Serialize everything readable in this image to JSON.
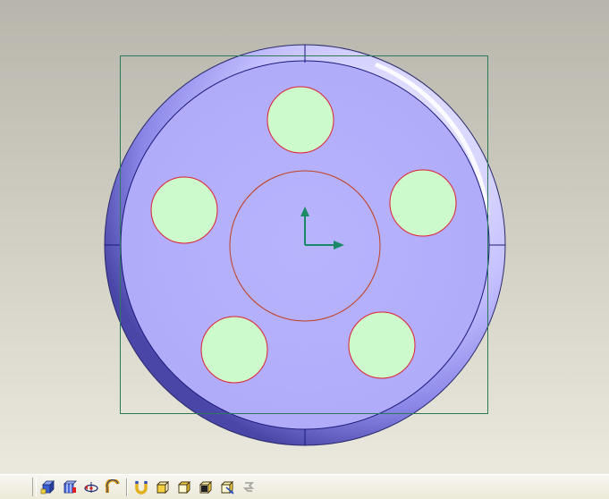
{
  "viewport": {
    "background_top": "#b8b6ac",
    "background_bottom": "#ebe9dd",
    "part_face_color": "#b4b0fc",
    "part_rim_color": "#8a86e8",
    "part_edge_color": "#1a1a7a",
    "hole_fill_color": "#ccfacc",
    "hole_edge_color": "#e02030",
    "center_circle_color": "#c24020",
    "bounding_box_color": "#2a7a5a",
    "axis_color": "#1a8a66"
  },
  "toolbar": {
    "buttons": [
      {
        "name": "shaded-view-button",
        "icon": "shaded-box-icon"
      },
      {
        "name": "hidden-lines-button",
        "icon": "hidden-lines-icon"
      },
      {
        "name": "rotate-view-button",
        "icon": "rotate-icon"
      },
      {
        "name": "sketch-curve-button",
        "icon": "curve-icon"
      },
      {
        "name": "magnet-snap-button",
        "icon": "magnet-icon"
      },
      {
        "name": "front-view-button",
        "icon": "view-front-icon"
      },
      {
        "name": "iso-view-button",
        "icon": "view-iso-icon"
      },
      {
        "name": "top-view-button",
        "icon": "view-top-icon"
      },
      {
        "name": "side-view-button",
        "icon": "view-side-icon"
      },
      {
        "name": "disabled-view-button",
        "icon": "refresh-disabled-icon"
      }
    ]
  }
}
